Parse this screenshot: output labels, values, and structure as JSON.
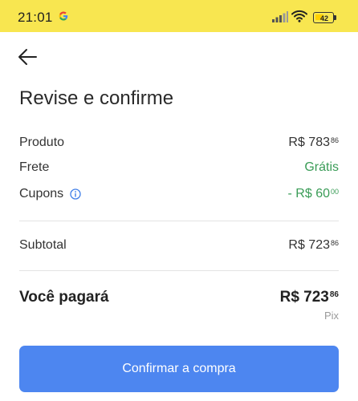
{
  "status_bar": {
    "time": "21:01",
    "battery_level": "42",
    "background_color": "#f8e650"
  },
  "header": {
    "back_icon": "arrow-left-icon"
  },
  "title": "Revise e confirme",
  "summary": {
    "product": {
      "label": "Produto",
      "amount": "R$ 783",
      "cents": "86"
    },
    "shipping": {
      "label": "Frete",
      "value": "Grátis"
    },
    "coupons": {
      "label": "Cupons",
      "icon": "info-icon",
      "amount": "- R$ 60",
      "cents": "00"
    },
    "subtotal": {
      "label": "Subtotal",
      "amount": "R$ 723",
      "cents": "86"
    }
  },
  "total": {
    "label": "Você pagará",
    "amount": "R$ 723",
    "cents": "86",
    "payment_method": "Pix"
  },
  "confirm_button": {
    "label": "Confirmar a compra",
    "color": "#4d86f0"
  },
  "colors": {
    "positive": "#3a9c57",
    "accent": "#4d86f0"
  }
}
